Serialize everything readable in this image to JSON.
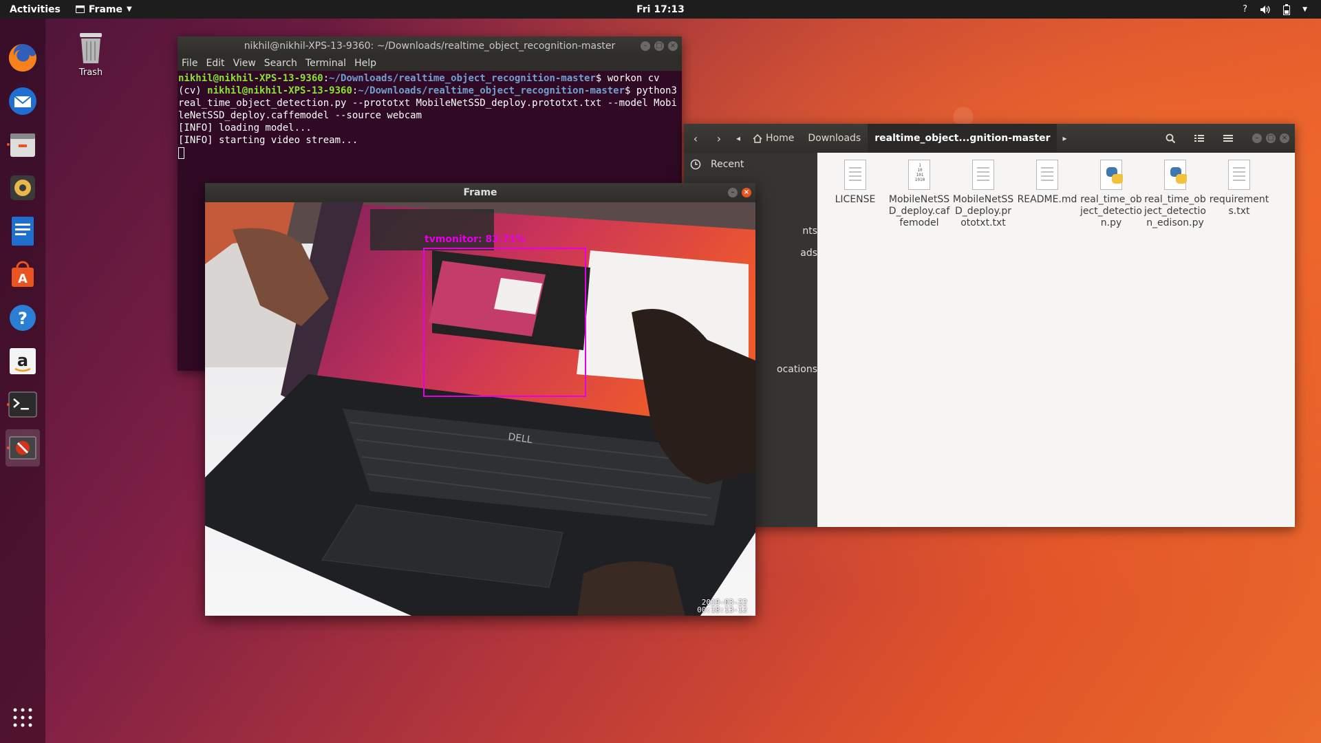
{
  "topbar": {
    "activities": "Activities",
    "app_menu": "Frame",
    "clock": "Fri 17:13",
    "help": "?"
  },
  "dock": {
    "items": [
      {
        "name": "firefox",
        "icon": "firefox-icon"
      },
      {
        "name": "thunderbird",
        "icon": "mail-icon"
      },
      {
        "name": "files",
        "icon": "files-icon"
      },
      {
        "name": "rhythmbox",
        "icon": "music-icon"
      },
      {
        "name": "writer",
        "icon": "document-icon"
      },
      {
        "name": "software",
        "icon": "software-store-icon"
      },
      {
        "name": "help",
        "icon": "help-icon"
      },
      {
        "name": "amazon",
        "icon": "amazon-icon"
      },
      {
        "name": "terminal",
        "icon": "terminal-icon"
      },
      {
        "name": "frame",
        "icon": "no-entry-icon"
      }
    ]
  },
  "desktop": {
    "trash_label": "Trash"
  },
  "terminal": {
    "title": "nikhil@nikhil-XPS-13-9360: ~/Downloads/realtime_object_recognition-master",
    "menu": [
      "File",
      "Edit",
      "View",
      "Search",
      "Terminal",
      "Help"
    ],
    "user_host": "nikhil@nikhil-XPS-13-9360",
    "path": "~/Downloads/realtime_object_recognition-master",
    "line1_cmd": "$ workon cv",
    "env": "(cv) ",
    "line2_cmd": "$ python3 real_time_object_detection.py --prototxt MobileNetSSD_deploy.prototxt.txt --model MobileNetSSD_deploy.caffemodel --source webcam",
    "out1": "[INFO] loading model...",
    "out2": "[INFO] starting video stream..."
  },
  "files": {
    "breadcrumbs": [
      "Home",
      "Downloads",
      "realtime_object...gnition-master"
    ],
    "sidebar": {
      "recent": "Recent",
      "partial_1": "nts",
      "partial_2": "ads",
      "partial_3": "ocations"
    },
    "items": [
      {
        "name": "LICENSE",
        "type": "text"
      },
      {
        "name": "MobileNetSSD_deploy.caffemodel",
        "type": "binary"
      },
      {
        "name": "MobileNetSSD_deploy.prototxt.txt",
        "type": "text"
      },
      {
        "name": "README.md",
        "type": "text"
      },
      {
        "name": "real_time_object_detection.py",
        "type": "python"
      },
      {
        "name": "real_time_object_detection_edison.py",
        "type": "python"
      },
      {
        "name": "requirements.txt",
        "type": "text"
      }
    ],
    "binary_glyph": "1\n10\n101\n1010"
  },
  "frame": {
    "title": "Frame",
    "detection_label": "tvmonitor: 83.71%",
    "timestamp_date": "2019-03-22",
    "timestamp_time": "00:18:13-12"
  },
  "colors": {
    "accent": "#e95420",
    "detection": "#e600e6",
    "terminal_bg": "#300a24"
  }
}
